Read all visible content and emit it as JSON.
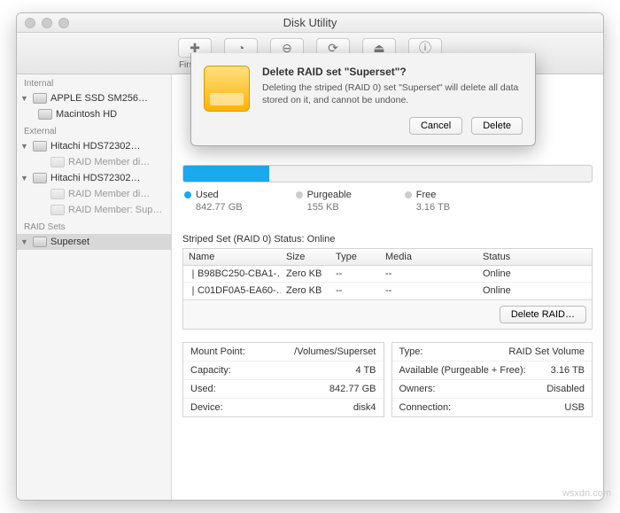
{
  "window": {
    "title": "Disk Utility"
  },
  "toolbar": {
    "items": [
      {
        "label": "First Aid",
        "glyph": "✚"
      },
      {
        "label": "Partition",
        "glyph": "◔"
      },
      {
        "label": "Erase",
        "glyph": "⊖"
      },
      {
        "label": "Restore",
        "glyph": "⟳"
      },
      {
        "label": "Unmount",
        "glyph": "⏏"
      },
      {
        "label": "Info",
        "glyph": "ⓘ"
      }
    ]
  },
  "sidebar": {
    "groups": [
      {
        "header": "Internal",
        "items": [
          {
            "label": "APPLE SSD SM256…",
            "level": 1,
            "disclosed": true
          },
          {
            "label": "Macintosh HD",
            "level": 2
          }
        ]
      },
      {
        "header": "External",
        "items": [
          {
            "label": "Hitachi HDS72302…",
            "level": 1,
            "disclosed": true
          },
          {
            "label": "RAID Member di…",
            "level": 3
          },
          {
            "label": "Hitachi HDS72302…",
            "level": 1,
            "disclosed": true
          },
          {
            "label": "RAID Member di…",
            "level": 3
          },
          {
            "label": "RAID Member: Sup…",
            "level": 3
          }
        ]
      },
      {
        "header": "RAID Sets",
        "items": [
          {
            "label": "Superset",
            "level": 1,
            "selected": true
          }
        ]
      }
    ]
  },
  "usage": {
    "used": {
      "label": "Used",
      "value": "842.77 GB"
    },
    "purgeable": {
      "label": "Purgeable",
      "value": "155 KB"
    },
    "free": {
      "label": "Free",
      "value": "3.16 TB"
    }
  },
  "striped": {
    "heading": "Striped Set (RAID 0) Status: Online",
    "columns": {
      "name": "Name",
      "size": "Size",
      "type": "Type",
      "media": "Media",
      "status": "Status"
    },
    "rows": [
      {
        "name": "B98BC250-CBA1-…",
        "size": "Zero KB",
        "type": "--",
        "media": "--",
        "status": "Online"
      },
      {
        "name": "C01DF0A5-EA60-…",
        "size": "Zero KB",
        "type": "--",
        "media": "--",
        "status": "Online"
      }
    ],
    "delete_label": "Delete RAID…"
  },
  "props": {
    "left": [
      {
        "k": "Mount Point:",
        "v": "/Volumes/Superset"
      },
      {
        "k": "Capacity:",
        "v": "4 TB"
      },
      {
        "k": "Used:",
        "v": "842.77 GB"
      },
      {
        "k": "Device:",
        "v": "disk4"
      }
    ],
    "right": [
      {
        "k": "Type:",
        "v": "RAID Set Volume"
      },
      {
        "k": "Available (Purgeable + Free):",
        "v": "3.16 TB"
      },
      {
        "k": "Owners:",
        "v": "Disabled"
      },
      {
        "k": "Connection:",
        "v": "USB"
      }
    ]
  },
  "dialog": {
    "title": "Delete RAID set \"Superset\"?",
    "desc": "Deleting the striped (RAID 0) set \"Superset\" will delete all data stored on it, and cannot be undone.",
    "cancel": "Cancel",
    "delete": "Delete"
  },
  "watermark": "wsxdn.com"
}
